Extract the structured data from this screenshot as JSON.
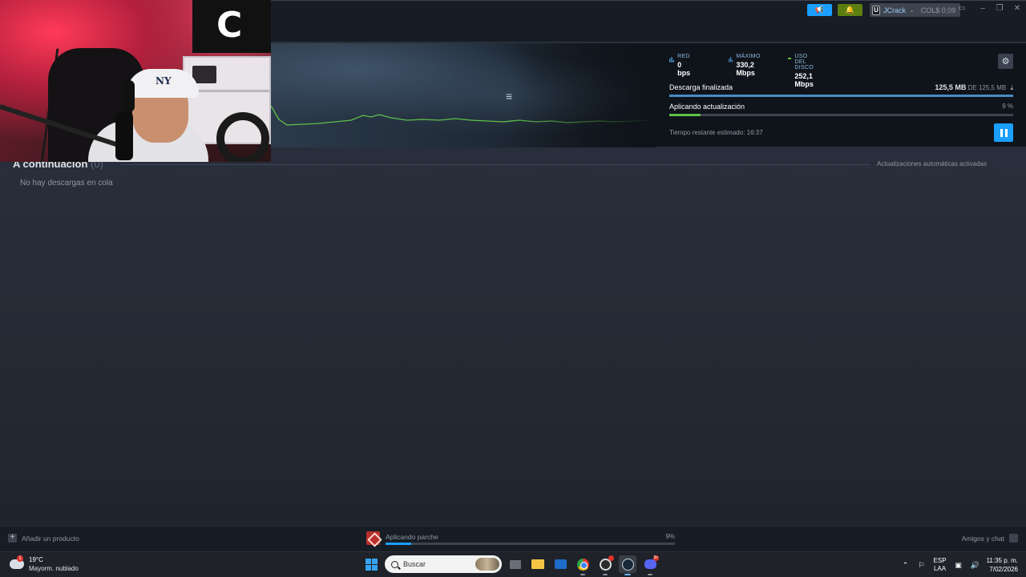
{
  "topbar": {
    "user_initial": "U",
    "username": "JCrack",
    "wallet": "COL$ 0,09",
    "accent": "#1a9fff",
    "notify_color": "#5c7e10"
  },
  "download": {
    "stats": {
      "network": {
        "label": "RED",
        "value": "0 bps"
      },
      "peak": {
        "label": "MÁXIMO",
        "value": "330,2 Mbps"
      },
      "disk": {
        "label": "USO DEL DISCO",
        "value": "252,1 Mbps"
      }
    },
    "download_row": {
      "label": "Descarga finalizada",
      "amount": "125,5 MB",
      "of_label": "DE 125,5 MB",
      "progress": 1.0
    },
    "apply_row": {
      "label": "Aplicando actualización",
      "percent_text": "9 %",
      "progress": 0.09
    },
    "time_left": "Tiempo restante estimado: 16:37"
  },
  "queue": {
    "title": "A continuación",
    "count": "(0)",
    "empty_message": "No hay descargas en cola",
    "auto_updates": "Actualizaciones automáticas activadas"
  },
  "bottom_bar": {
    "add_product": "Añadir un producto",
    "patch_label": "Aplicando parche",
    "patch_percent": "9%",
    "patch_progress": 0.09,
    "friends": "Amigos y chat"
  },
  "taskbar": {
    "weather_badge": "1",
    "temperature": "19°C",
    "condition": "Mayorm. nublado",
    "search_placeholder": "Buscar",
    "discord_badge": "9+",
    "lang_top": "ESP",
    "lang_bottom": "LAA",
    "time": "11:35 p. m.",
    "date": "7/02/2026"
  }
}
